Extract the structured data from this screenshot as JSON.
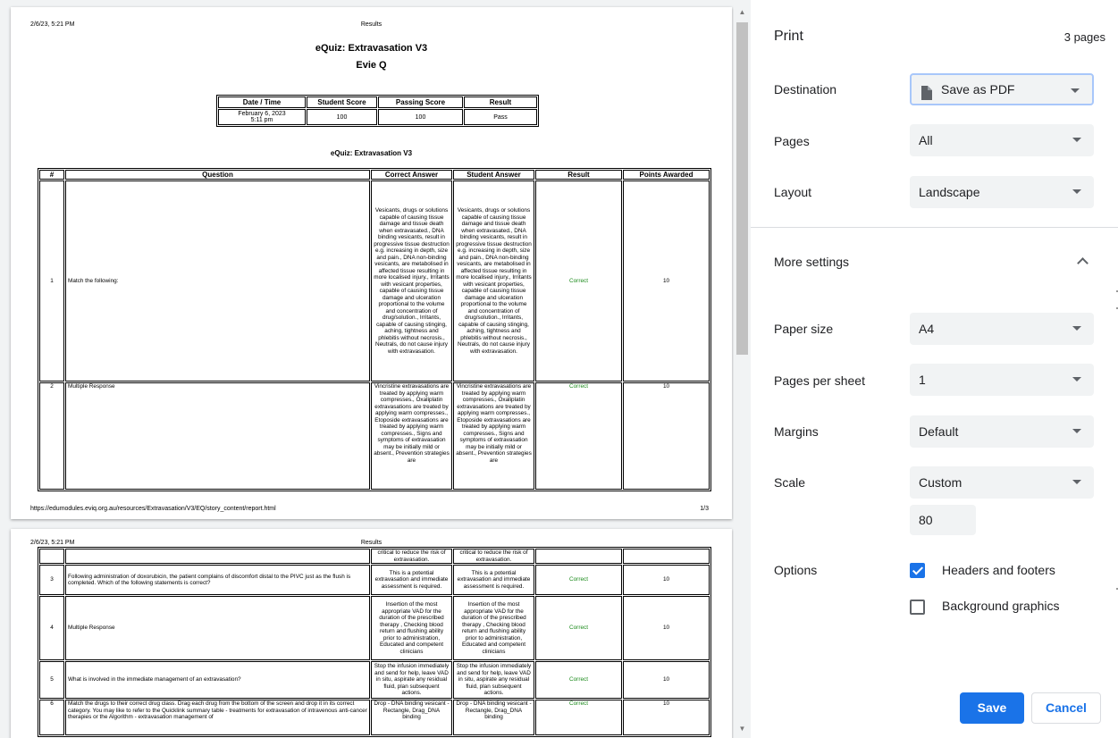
{
  "panel": {
    "title": "Print",
    "page_count": "3 pages",
    "destination": {
      "label": "Destination",
      "value": "Save as PDF"
    },
    "pages": {
      "label": "Pages",
      "value": "All"
    },
    "layout": {
      "label": "Layout",
      "value": "Landscape"
    },
    "more_settings": "More settings",
    "paper_size": {
      "label": "Paper size",
      "value": "A4"
    },
    "pages_per_sheet": {
      "label": "Pages per sheet",
      "value": "1"
    },
    "margins": {
      "label": "Margins",
      "value": "Default"
    },
    "scale": {
      "label": "Scale",
      "value": "Custom",
      "custom_value": "80"
    },
    "options": {
      "label": "Options",
      "headers_footers": "Headers and footers",
      "headers_footers_checked": true,
      "background_graphics": "Background graphics",
      "background_graphics_checked": false
    },
    "save_label": "Save",
    "cancel_label": "Cancel"
  },
  "preview": {
    "page1": {
      "header_date": "2/6/23, 5:21 PM",
      "header_title": "Results",
      "title": "eQuiz: Extravasation V3",
      "student": "Evie Q",
      "summary_headers": [
        "Date / Time",
        "Student Score",
        "Passing Score",
        "Result"
      ],
      "summary_values": [
        "February 6, 2023 5:11 pm",
        "100",
        "100",
        "Pass"
      ],
      "table_title": "eQuiz: Extravasation V3",
      "table_headers": [
        "#",
        "Question",
        "Correct Answer",
        "Student Answer",
        "Result",
        "Points Awarded"
      ],
      "row1": {
        "num": "1",
        "question": "Match the following:",
        "answer": "Vesicants, drugs or solutions capable of causing tissue damage and tissue death when extravasated., DNA binding vesicants, result in progressive tissue destruction e.g. increasing in depth, size and pain., DNA non-binding vesicants, are metabolised in affected tissue resulting in more localised injury., Irritants with vesicant properties, capable of causing tissue damage and ulceration proportional to the volume and concentration of drug/solution., Irritants, capable of causing stinging, aching, tightness and phlebitis without necrosis., Neutrals, do not cause injury with extravasation.",
        "result": "Correct",
        "points": "10"
      },
      "row2": {
        "num": "2",
        "question": "Multiple Response",
        "answer": "Vincristine extravasations are treated by applying warm compresses., Oxaliplatin extravasations are treated by applying warm compresses., Etoposide extravasations are treated by applying warm compresses., Signs and symptoms of extravasation may be initially mild or absent., Prevention strategies are",
        "result": "Correct",
        "points": "10"
      },
      "footer_url": "https://edumodules.eviq.org.au/resources/Extravasation/V3/EQ/story_content/report.html",
      "footer_page": "1/3"
    },
    "page2": {
      "header_date": "2/6/23, 5:21 PM",
      "header_title": "Results",
      "row_cont": {
        "answer": "critical to reduce the risk of extravasation."
      },
      "row3": {
        "num": "3",
        "question": "Following administration of doxorubicin, the patient complains of discomfort distal to the PIVC just as the flush is completed. Which of the following statements is correct?",
        "answer": "This is a potential extravasation and immediate assessment is required.",
        "result": "Correct",
        "points": "10"
      },
      "row4": {
        "num": "4",
        "question": "Multiple Response",
        "answer": "Insertion of the most appropriate VAD for the duration of the prescribed therapy , Checking blood return and flushing ability prior to administration, Educated and competent clinicians",
        "result": "Correct",
        "points": "10"
      },
      "row5": {
        "num": "5",
        "question": "What is involved in the immediate management of an extravasation?",
        "answer": "Stop the infusion immediately and send for help, leave VAD in situ, aspirate any residual fluid, plan subsequent actions.",
        "result": "Correct",
        "points": "10"
      },
      "row6": {
        "num": "6",
        "question": "Match the drugs to their correct drug class. Drag each drug from the bottom of the screen and drop it in its correct category. You may like to refer to the Quicklink summary table - treatments for extravasation of intravenous anti-cancer therapies or the Algorithm - extravasation management of",
        "answer": "Drop - DNA binding vesicant - Rectangle, Drag_DNA binding",
        "result": "Correct",
        "points": "10"
      }
    }
  }
}
